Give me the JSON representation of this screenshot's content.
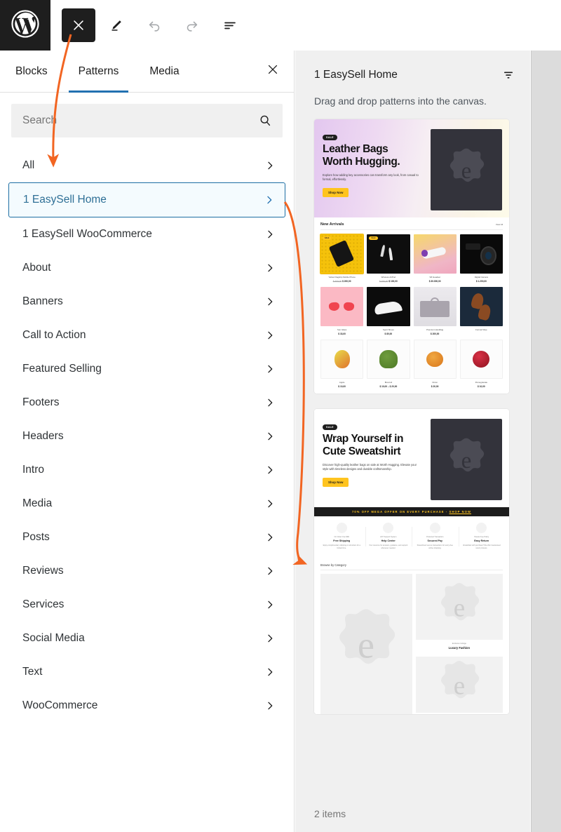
{
  "editor_toolbar": {
    "logo_icon": "wordpress-logo-icon",
    "buttons": [
      {
        "name": "close-inserter-button",
        "icon": "close-x-icon",
        "label": "",
        "state": "active"
      },
      {
        "name": "tools-edit-button",
        "icon": "pencil-icon",
        "label": "",
        "state": "default"
      },
      {
        "name": "undo-button",
        "icon": "undo-arrow-icon",
        "label": "",
        "state": "disabled"
      },
      {
        "name": "redo-button",
        "icon": "redo-arrow-icon",
        "label": "",
        "state": "disabled"
      },
      {
        "name": "list-view-button",
        "icon": "list-view-icon",
        "label": "",
        "state": "default"
      }
    ]
  },
  "inserter": {
    "tabs": [
      {
        "label": "Blocks",
        "selected": false
      },
      {
        "label": "Patterns",
        "selected": true
      },
      {
        "label": "Media",
        "selected": false
      }
    ],
    "close_label": "Close",
    "close_icon": "close-x-icon",
    "search": {
      "value": "",
      "placeholder": "Search",
      "icon": "search-icon"
    },
    "chevron_icon": "chevron-right-icon",
    "categories": [
      {
        "label": "All",
        "selected": false
      },
      {
        "label": "1 EasySell Home",
        "selected": true
      },
      {
        "label": "1 EasySell WooCommerce",
        "selected": false
      },
      {
        "label": "About",
        "selected": false
      },
      {
        "label": "Banners",
        "selected": false
      },
      {
        "label": "Call to Action",
        "selected": false
      },
      {
        "label": "Featured Selling",
        "selected": false
      },
      {
        "label": "Footers",
        "selected": false
      },
      {
        "label": "Headers",
        "selected": false
      },
      {
        "label": "Intro",
        "selected": false
      },
      {
        "label": "Media",
        "selected": false
      },
      {
        "label": "Posts",
        "selected": false
      },
      {
        "label": "Reviews",
        "selected": false
      },
      {
        "label": "Services",
        "selected": false
      },
      {
        "label": "Social Media",
        "selected": false
      },
      {
        "label": "Text",
        "selected": false
      },
      {
        "label": "WooCommerce",
        "selected": false
      }
    ]
  },
  "preview_panel": {
    "title": "1 EasySell Home",
    "filter_icon": "filter-sort-icon",
    "instruction": "Drag and drop patterns into the canvas.",
    "item_count_label": "2 items",
    "patterns": [
      {
        "name": "pattern-easysell-home-1",
        "hero": {
          "badge": "SALE",
          "heading_line1": "Leather Bags",
          "heading_line2": "Worth Hugging.",
          "paragraph": "Explore how adding key accessories can transform any look, from casual to formal, effortlessly.",
          "button": "Shop Now"
        },
        "products_section": {
          "title": "New Arrivals",
          "link": "View All",
          "rows": [
            [
              {
                "name": "Yellow Flagship Mobile Phone",
                "price": "$ 200,00",
                "old_price": "$ 400,00",
                "badge": "SALE"
              },
              {
                "name": "Wireless AirPod",
                "price": "$ 100,00",
                "old_price": "$ 150,00",
                "badge": "SALE"
              },
              {
                "name": "VR Headset",
                "price": "$ 30.000,00",
                "old_price": "",
                "badge": ""
              },
              {
                "name": "Digital Camera",
                "price": "$ 1.200,00",
                "old_price": "",
                "badge": ""
              }
            ],
            [
              {
                "name": "Sun Glass",
                "price": "$ 33,00",
                "old_price": "",
                "badge": ""
              },
              {
                "name": "Sport Shoes",
                "price": "$ 80,00",
                "old_price": "",
                "badge": ""
              },
              {
                "name": "Premium Handbag",
                "price": "$ 200,00",
                "old_price": "",
                "badge": ""
              },
              {
                "name": "Formal Shoe",
                "price": "",
                "old_price": "",
                "badge": ""
              }
            ],
            [
              {
                "name": "Apple",
                "price": "$ 10,00",
                "old_price": "",
                "badge": ""
              },
              {
                "name": "Broccoli",
                "price": "$ 10,00 – $ 20,00",
                "old_price": "",
                "badge": ""
              },
              {
                "name": "Onion",
                "price": "$ 20,00",
                "old_price": "",
                "badge": ""
              },
              {
                "name": "Pomegranate",
                "price": "$ 10,00",
                "old_price": "",
                "badge": ""
              }
            ]
          ]
        }
      },
      {
        "name": "pattern-easysell-home-2",
        "hero": {
          "badge": "SALE",
          "heading_line1": "Wrap Yourself in",
          "heading_line2": "Cute Sweatshirt",
          "paragraph": "Discover high-quality leather bags on sale at Worth Hugging. Elevate your style with timeless designs and durable craftsmanship.",
          "button": "Shop Now"
        },
        "offer_bar": {
          "text": "70% OFF MEGA OFFER ON EVERY PURCHASE -",
          "link": "SHOP NOW"
        },
        "features": [
          {
            "sub": "On Order Over $80",
            "title": "Free Shipping",
            "desc": "Enjoy complimentary shipping on all orders for a limited time."
          },
          {
            "sub": "24/7 Support System",
            "title": "Help Center",
            "desc": "Your resource for answers, guidance, and support whenever needed."
          },
          {
            "sub": "Protected Transaction",
            "title": "Secured Pay",
            "desc": "Streamlined secure transactions for worry-free online shopping."
          },
          {
            "sub": "Hassle Free Policy",
            "title": "Easy Return",
            "desc": "Unsatisfied with purchase? We offer Guaranteed return process."
          }
        ],
        "categories_section": {
          "title": "Browse by Category",
          "tiles": [
            {
              "subtitle": "",
              "title": ""
            },
            {
              "subtitle": "Exclusive Indulge",
              "title": "Luxury Fashion"
            },
            {
              "subtitle": "",
              "title": ""
            }
          ]
        }
      }
    ]
  },
  "annotations": {
    "accent_color": "#f26522",
    "arrows": [
      {
        "name": "arrow-to-category-list",
        "from": "close-inserter-button",
        "to": "category-all"
      },
      {
        "name": "arrow-to-pattern-preview",
        "from": "category-easysell-home",
        "to": "pattern-preview-list"
      }
    ]
  },
  "colors": {
    "brand_blue": "#2271b1",
    "selected_bg": "#f4fbfe",
    "panel_bg": "#f0f0f0",
    "dark": "#1e1e1e",
    "accent_orange": "#f26522",
    "yellow": "#ffc41f"
  }
}
